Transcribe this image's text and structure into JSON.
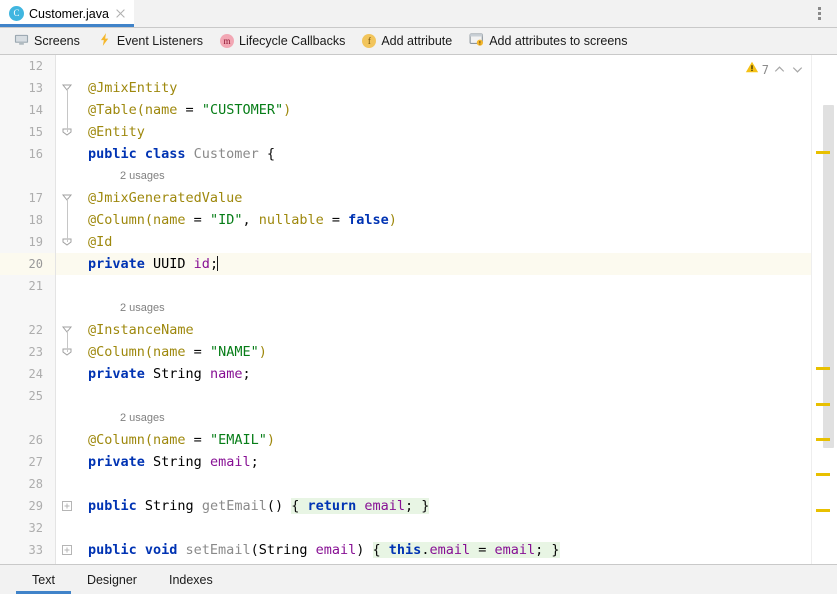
{
  "colors": {
    "accent": "#4083c9",
    "annotation": "#9e880d",
    "keyword": "#0033b3",
    "string": "#067d17",
    "field": "#871094",
    "inlay": "#808080",
    "warning_marker": "#e8c000",
    "caret_row": "#fcfaef",
    "inline_body": "#e8f5e4",
    "toolbar_bg": "#f2f2f2",
    "gutter_bg": "#f7f7f7"
  },
  "tabbar": {
    "tab": {
      "icon": "java-class-icon",
      "icon_letter": "C",
      "title": "Customer.java",
      "close": "close-icon"
    },
    "overflow": "more-options-icon"
  },
  "plugin_toolbar": {
    "items": [
      {
        "icon": "screens-monitor-icon",
        "label": "Screens"
      },
      {
        "icon": "event-listeners-lightning-icon",
        "label": "Event Listeners"
      },
      {
        "icon": "lifecycle-callbacks-method-icon",
        "icon_letter": "m",
        "label": "Lifecycle Callbacks"
      },
      {
        "icon": "add-attribute-field-icon",
        "icon_letter": "f",
        "label": "Add attribute"
      },
      {
        "icon": "add-attributes-to-screens-icon",
        "label": "Add attributes to screens"
      }
    ]
  },
  "inspection": {
    "icon": "warning-triangle-icon",
    "count": "7",
    "prev": "chevron-up-icon",
    "next": "chevron-down-icon"
  },
  "editor": {
    "language": "java",
    "file": "Customer.java",
    "caret_line": 20,
    "rows": [
      {
        "num": "12",
        "type": "code",
        "fold": "",
        "tokens": []
      },
      {
        "num": "13",
        "type": "code",
        "fold": "collapse-arrow",
        "tokens": [
          {
            "c": "t-anno",
            "t": "@JmixEntity"
          }
        ]
      },
      {
        "num": "14",
        "type": "code",
        "fold": "",
        "tokens": [
          {
            "c": "t-anno",
            "t": "@Table("
          },
          {
            "c": "t-anno",
            "t": "name"
          },
          {
            "c": "t-punct",
            "t": " = "
          },
          {
            "c": "t-str",
            "t": "\"CUSTOMER\""
          },
          {
            "c": "t-anno",
            "t": ")"
          }
        ]
      },
      {
        "num": "15",
        "type": "code",
        "fold": "collapse-minus",
        "tokens": [
          {
            "c": "t-anno",
            "t": "@Entity"
          }
        ]
      },
      {
        "num": "16",
        "type": "code",
        "fold": "",
        "tokens": [
          {
            "c": "t-kw",
            "t": "public class "
          },
          {
            "c": "t-cls",
            "t": "Customer"
          },
          {
            "c": "t-punct",
            "t": " {"
          }
        ]
      },
      {
        "num": "",
        "type": "inlay",
        "fold": "",
        "text": "2 usages"
      },
      {
        "num": "17",
        "type": "code",
        "fold": "collapse-arrow",
        "tokens": [
          {
            "c": "t-anno",
            "t": "@JmixGeneratedValue"
          }
        ]
      },
      {
        "num": "18",
        "type": "code",
        "fold": "",
        "tokens": [
          {
            "c": "t-anno",
            "t": "@Column("
          },
          {
            "c": "t-anno",
            "t": "name"
          },
          {
            "c": "t-punct",
            "t": " = "
          },
          {
            "c": "t-str",
            "t": "\"ID\""
          },
          {
            "c": "t-punct",
            "t": ", "
          },
          {
            "c": "t-anno",
            "t": "nullable"
          },
          {
            "c": "t-punct",
            "t": " = "
          },
          {
            "c": "t-kw",
            "t": "false"
          },
          {
            "c": "t-anno",
            "t": ")"
          }
        ]
      },
      {
        "num": "19",
        "type": "code",
        "fold": "collapse-minus",
        "tokens": [
          {
            "c": "t-anno",
            "t": "@Id"
          }
        ]
      },
      {
        "num": "20",
        "type": "code",
        "fold": "",
        "current": true,
        "tokens": [
          {
            "c": "t-kw",
            "t": "private "
          },
          {
            "c": "t-type",
            "t": "UUID "
          },
          {
            "c": "t-field",
            "t": "id"
          },
          {
            "c": "t-punct",
            "t": ";"
          }
        ],
        "caret": true
      },
      {
        "num": "21",
        "type": "code",
        "fold": "",
        "tokens": []
      },
      {
        "num": "",
        "type": "inlay",
        "fold": "",
        "text": "2 usages"
      },
      {
        "num": "22",
        "type": "code",
        "fold": "collapse-arrow",
        "tokens": [
          {
            "c": "t-anno",
            "t": "@InstanceName"
          }
        ]
      },
      {
        "num": "23",
        "type": "code",
        "fold": "collapse-minus",
        "tokens": [
          {
            "c": "t-anno",
            "t": "@Column("
          },
          {
            "c": "t-anno",
            "t": "name"
          },
          {
            "c": "t-punct",
            "t": " = "
          },
          {
            "c": "t-str",
            "t": "\"NAME\""
          },
          {
            "c": "t-anno",
            "t": ")"
          }
        ]
      },
      {
        "num": "24",
        "type": "code",
        "fold": "",
        "tokens": [
          {
            "c": "t-kw",
            "t": "private "
          },
          {
            "c": "t-type",
            "t": "String "
          },
          {
            "c": "t-field",
            "t": "name"
          },
          {
            "c": "t-punct",
            "t": ";"
          }
        ]
      },
      {
        "num": "25",
        "type": "code",
        "fold": "",
        "tokens": []
      },
      {
        "num": "",
        "type": "inlay",
        "fold": "",
        "text": "2 usages"
      },
      {
        "num": "26",
        "type": "code",
        "fold": "",
        "tokens": [
          {
            "c": "t-anno",
            "t": "@Column("
          },
          {
            "c": "t-anno",
            "t": "name"
          },
          {
            "c": "t-punct",
            "t": " = "
          },
          {
            "c": "t-str",
            "t": "\"EMAIL\""
          },
          {
            "c": "t-anno",
            "t": ")"
          }
        ]
      },
      {
        "num": "27",
        "type": "code",
        "fold": "",
        "tokens": [
          {
            "c": "t-kw",
            "t": "private "
          },
          {
            "c": "t-type",
            "t": "String "
          },
          {
            "c": "t-field",
            "t": "email"
          },
          {
            "c": "t-punct",
            "t": ";"
          }
        ]
      },
      {
        "num": "28",
        "type": "code",
        "fold": "",
        "tokens": []
      },
      {
        "num": "29",
        "type": "code",
        "fold": "expand-plus",
        "tokens": [
          {
            "c": "t-kw",
            "t": "public "
          },
          {
            "c": "t-type",
            "t": "String "
          },
          {
            "c": "t-cls",
            "t": "getEmail"
          },
          {
            "c": "t-punct",
            "t": "() "
          },
          {
            "c": "t-punct hl-green",
            "t": "{ "
          },
          {
            "c": "t-kw hl-green",
            "t": "return "
          },
          {
            "c": "t-field hl-green",
            "t": "email"
          },
          {
            "c": "t-punct hl-green",
            "t": "; }"
          }
        ]
      },
      {
        "num": "32",
        "type": "code",
        "fold": "",
        "tokens": []
      },
      {
        "num": "33",
        "type": "code",
        "fold": "expand-plus",
        "tokens": [
          {
            "c": "t-kw",
            "t": "public void "
          },
          {
            "c": "t-cls",
            "t": "setEmail"
          },
          {
            "c": "t-punct",
            "t": "("
          },
          {
            "c": "t-type",
            "t": "String "
          },
          {
            "c": "t-field",
            "t": "email"
          },
          {
            "c": "t-punct",
            "t": ") "
          },
          {
            "c": "t-punct hl-green",
            "t": "{ "
          },
          {
            "c": "t-kw hl-green",
            "t": "this"
          },
          {
            "c": "t-punct hl-green",
            "t": "."
          },
          {
            "c": "t-field hl-green",
            "t": "email"
          },
          {
            "c": "t-punct hl-green",
            "t": " = "
          },
          {
            "c": "t-field hl-green",
            "t": "email"
          },
          {
            "c": "t-punct hl-green",
            "t": "; }"
          }
        ]
      }
    ],
    "scrollbar": {
      "top_pct": 10,
      "height_pct": 68
    },
    "warning_markers_pct": [
      19,
      62,
      69,
      76,
      83,
      90
    ]
  },
  "bottom_tabs": {
    "items": [
      {
        "label": "Text",
        "selected": true
      },
      {
        "label": "Designer",
        "selected": false
      },
      {
        "label": "Indexes",
        "selected": false
      }
    ]
  }
}
